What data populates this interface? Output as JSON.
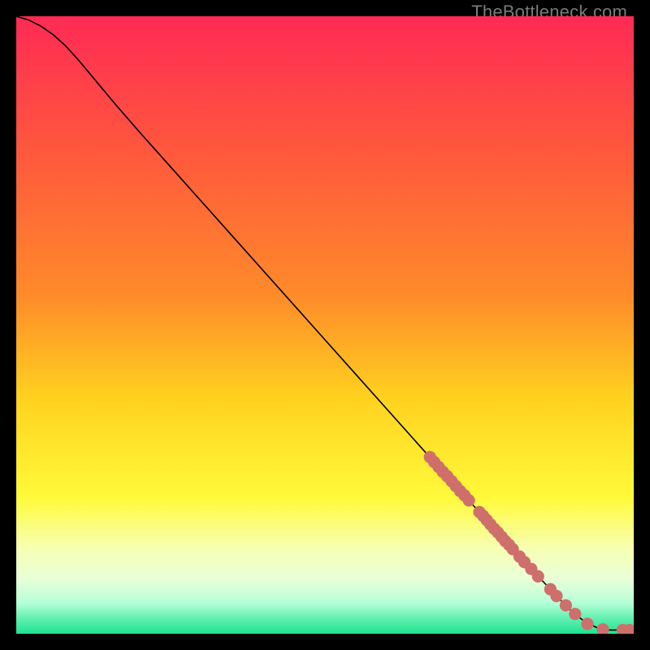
{
  "watermark": "TheBottleneck.com",
  "chart_data": {
    "type": "line",
    "title": "",
    "xlabel": "",
    "ylabel": "",
    "xlim": [
      0,
      100
    ],
    "ylim": [
      0,
      100
    ],
    "background_gradient_stops": [
      {
        "offset": 0.0,
        "color": "#ff2a55"
      },
      {
        "offset": 0.23,
        "color": "#ff5a3c"
      },
      {
        "offset": 0.45,
        "color": "#ff8a2a"
      },
      {
        "offset": 0.62,
        "color": "#ffd21f"
      },
      {
        "offset": 0.78,
        "color": "#fffa3a"
      },
      {
        "offset": 0.86,
        "color": "#f7ffb0"
      },
      {
        "offset": 0.91,
        "color": "#eaffd8"
      },
      {
        "offset": 0.95,
        "color": "#b6ffd7"
      },
      {
        "offset": 0.975,
        "color": "#62f0b0"
      },
      {
        "offset": 1.0,
        "color": "#1ee38f"
      }
    ],
    "series": [
      {
        "name": "curve",
        "stroke": "#000000",
        "stroke_width": 1.6,
        "points": [
          {
            "x": 0,
            "y": 100.0
          },
          {
            "x": 2,
            "y": 99.4
          },
          {
            "x": 4,
            "y": 98.4
          },
          {
            "x": 6,
            "y": 97.0
          },
          {
            "x": 8,
            "y": 95.2
          },
          {
            "x": 10,
            "y": 93.0
          },
          {
            "x": 12,
            "y": 90.6
          },
          {
            "x": 14,
            "y": 88.2
          },
          {
            "x": 16,
            "y": 85.8
          },
          {
            "x": 18,
            "y": 83.5
          },
          {
            "x": 20,
            "y": 81.2
          },
          {
            "x": 25,
            "y": 75.6
          },
          {
            "x": 30,
            "y": 70.0
          },
          {
            "x": 35,
            "y": 64.4
          },
          {
            "x": 40,
            "y": 58.8
          },
          {
            "x": 45,
            "y": 53.2
          },
          {
            "x": 50,
            "y": 47.6
          },
          {
            "x": 55,
            "y": 42.0
          },
          {
            "x": 60,
            "y": 36.4
          },
          {
            "x": 65,
            "y": 30.8
          },
          {
            "x": 70,
            "y": 25.2
          },
          {
            "x": 75,
            "y": 19.7
          },
          {
            "x": 80,
            "y": 14.2
          },
          {
            "x": 85,
            "y": 8.8
          },
          {
            "x": 88,
            "y": 5.6
          },
          {
            "x": 90,
            "y": 3.6
          },
          {
            "x": 92,
            "y": 2.0
          },
          {
            "x": 94,
            "y": 1.0
          },
          {
            "x": 95,
            "y": 0.7
          },
          {
            "x": 96,
            "y": 0.6
          },
          {
            "x": 98,
            "y": 0.6
          },
          {
            "x": 100,
            "y": 0.6
          }
        ]
      }
    ],
    "marker_color": "#cf6f6c",
    "marker_radius_data_units": 1.0,
    "markers": [
      {
        "x": 67.0,
        "y": 28.6
      },
      {
        "x": 67.7,
        "y": 27.8
      },
      {
        "x": 68.4,
        "y": 27.0
      },
      {
        "x": 69.1,
        "y": 26.2
      },
      {
        "x": 69.8,
        "y": 25.5
      },
      {
        "x": 70.5,
        "y": 24.7
      },
      {
        "x": 71.2,
        "y": 23.9
      },
      {
        "x": 71.9,
        "y": 23.1
      },
      {
        "x": 72.6,
        "y": 22.4
      },
      {
        "x": 73.3,
        "y": 21.6
      },
      {
        "x": 75.0,
        "y": 19.7
      },
      {
        "x": 75.6,
        "y": 19.1
      },
      {
        "x": 76.2,
        "y": 18.4
      },
      {
        "x": 76.8,
        "y": 17.7
      },
      {
        "x": 77.4,
        "y": 17.0
      },
      {
        "x": 78.0,
        "y": 16.4
      },
      {
        "x": 78.6,
        "y": 15.7
      },
      {
        "x": 79.2,
        "y": 15.0
      },
      {
        "x": 79.8,
        "y": 14.4
      },
      {
        "x": 80.4,
        "y": 13.7
      },
      {
        "x": 81.5,
        "y": 12.5
      },
      {
        "x": 82.3,
        "y": 11.6
      },
      {
        "x": 83.4,
        "y": 10.5
      },
      {
        "x": 84.5,
        "y": 9.3
      },
      {
        "x": 86.5,
        "y": 7.2
      },
      {
        "x": 87.5,
        "y": 6.1
      },
      {
        "x": 89.0,
        "y": 4.6
      },
      {
        "x": 90.5,
        "y": 3.2
      },
      {
        "x": 92.5,
        "y": 1.6
      },
      {
        "x": 95.0,
        "y": 0.7
      },
      {
        "x": 98.2,
        "y": 0.6
      },
      {
        "x": 99.3,
        "y": 0.6
      }
    ]
  }
}
